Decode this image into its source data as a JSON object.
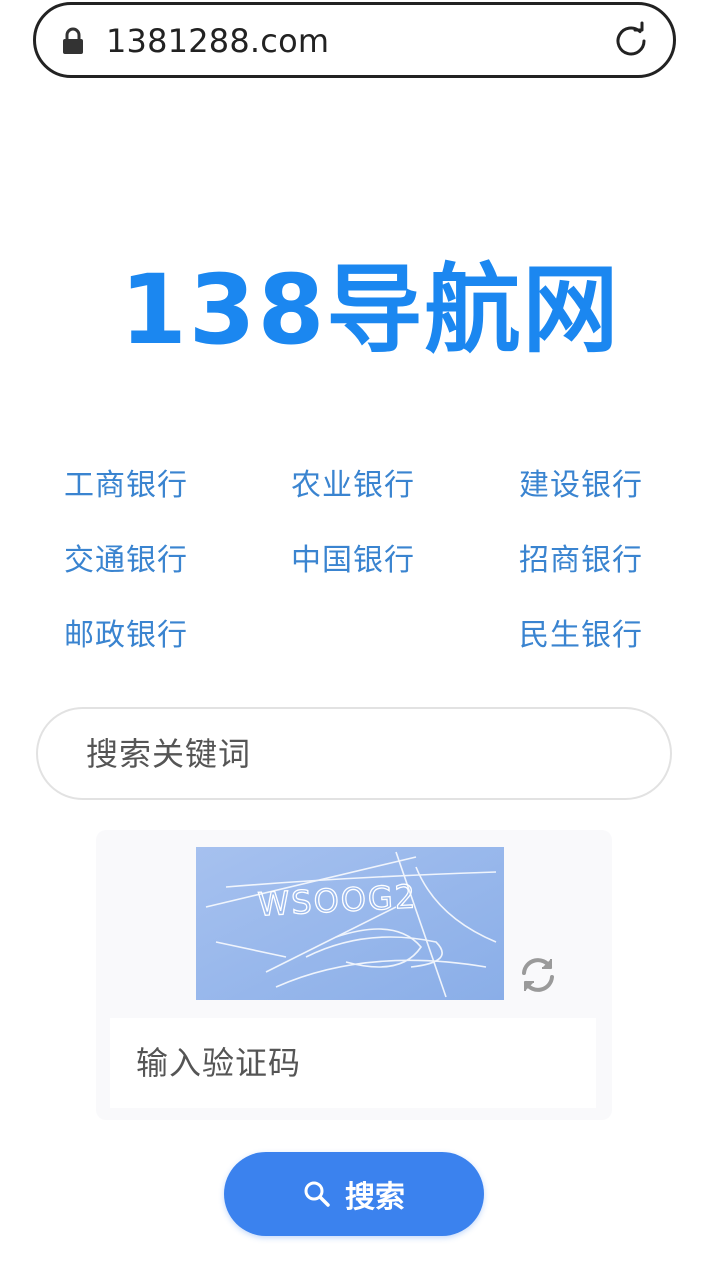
{
  "browser": {
    "url": "1381288.com",
    "icons": {
      "lock": "lock-icon",
      "reload": "reload-icon"
    }
  },
  "logo": {
    "text": "138导航网",
    "color": "#1b87f0"
  },
  "banks": [
    {
      "label": "工商银行"
    },
    {
      "label": "农业银行"
    },
    {
      "label": "建设银行"
    },
    {
      "label": "交通银行"
    },
    {
      "label": "中国银行"
    },
    {
      "label": "招商银行"
    },
    {
      "label": "邮政银行"
    },
    {
      "label": "民生银行"
    }
  ],
  "search": {
    "placeholder": "搜索关键词"
  },
  "captcha": {
    "text": "WSOOG2",
    "placeholder": "输入验证码",
    "refresh_icon": "refresh-icon"
  },
  "search_button": {
    "label": "搜索",
    "icon": "search-icon",
    "color": "#3b82ee"
  }
}
